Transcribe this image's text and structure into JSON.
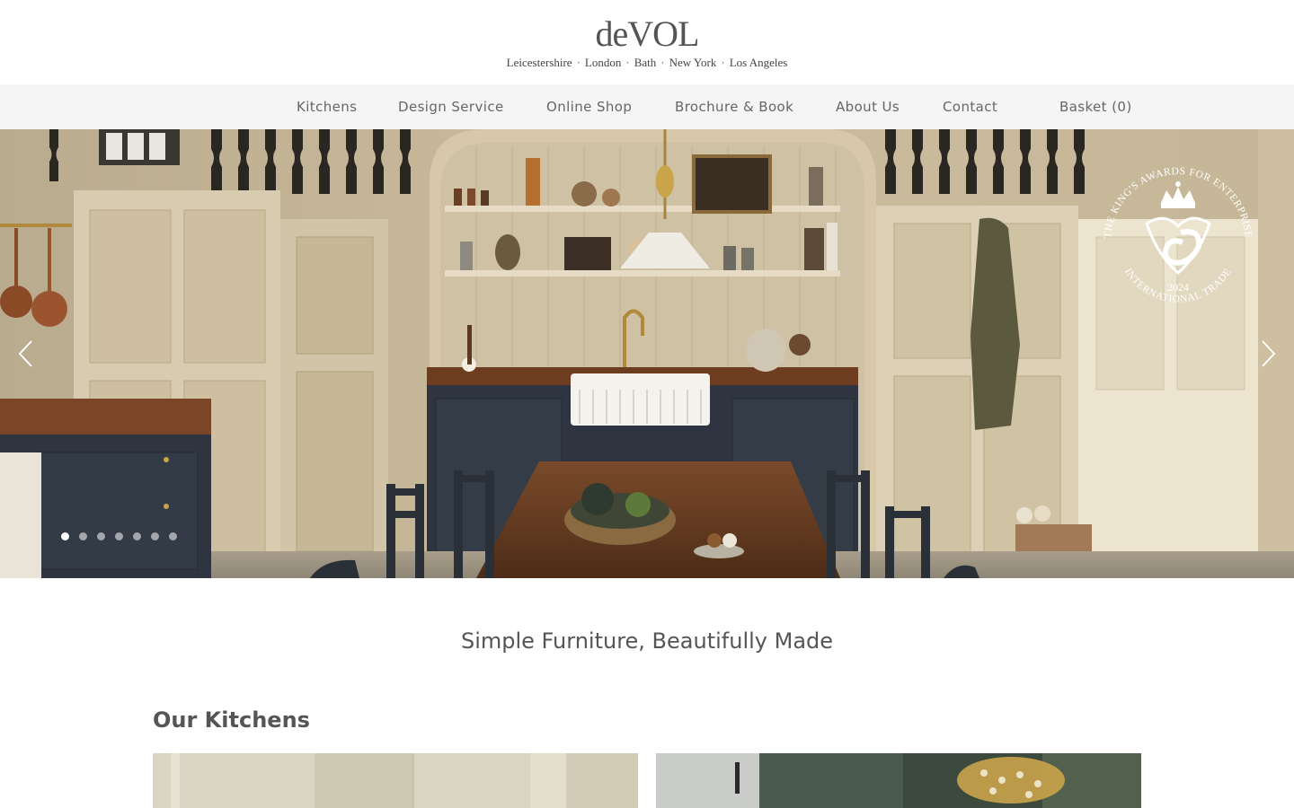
{
  "brand": {
    "logo": "deVOL",
    "locations": [
      "Leicestershire",
      "London",
      "Bath",
      "New York",
      "Los Angeles"
    ],
    "separator": "·"
  },
  "nav": {
    "items": [
      "Kitchens",
      "Design Service",
      "Online Shop",
      "Brochure & Book",
      "About Us",
      "Contact"
    ],
    "basket": "Basket (0)"
  },
  "hero": {
    "slide_count": 7,
    "active_slide": 1,
    "prev_icon": "chevron-left-icon",
    "next_icon": "chevron-right-icon",
    "award": {
      "top_text": "THE KING'S AWARDS FOR ENTERPRISE",
      "bottom_text": "INTERNATIONAL TRADE",
      "year": "2024",
      "emblem": "crown-icon"
    }
  },
  "main": {
    "tagline": "Simple Furniture, Beautifully Made",
    "section_title": "Our Kitchens"
  },
  "colors": {
    "nav_bg": "#f5f5f5",
    "text": "#555555",
    "cabinet_navy": "#2e3540",
    "wood": "#6b3f22"
  }
}
